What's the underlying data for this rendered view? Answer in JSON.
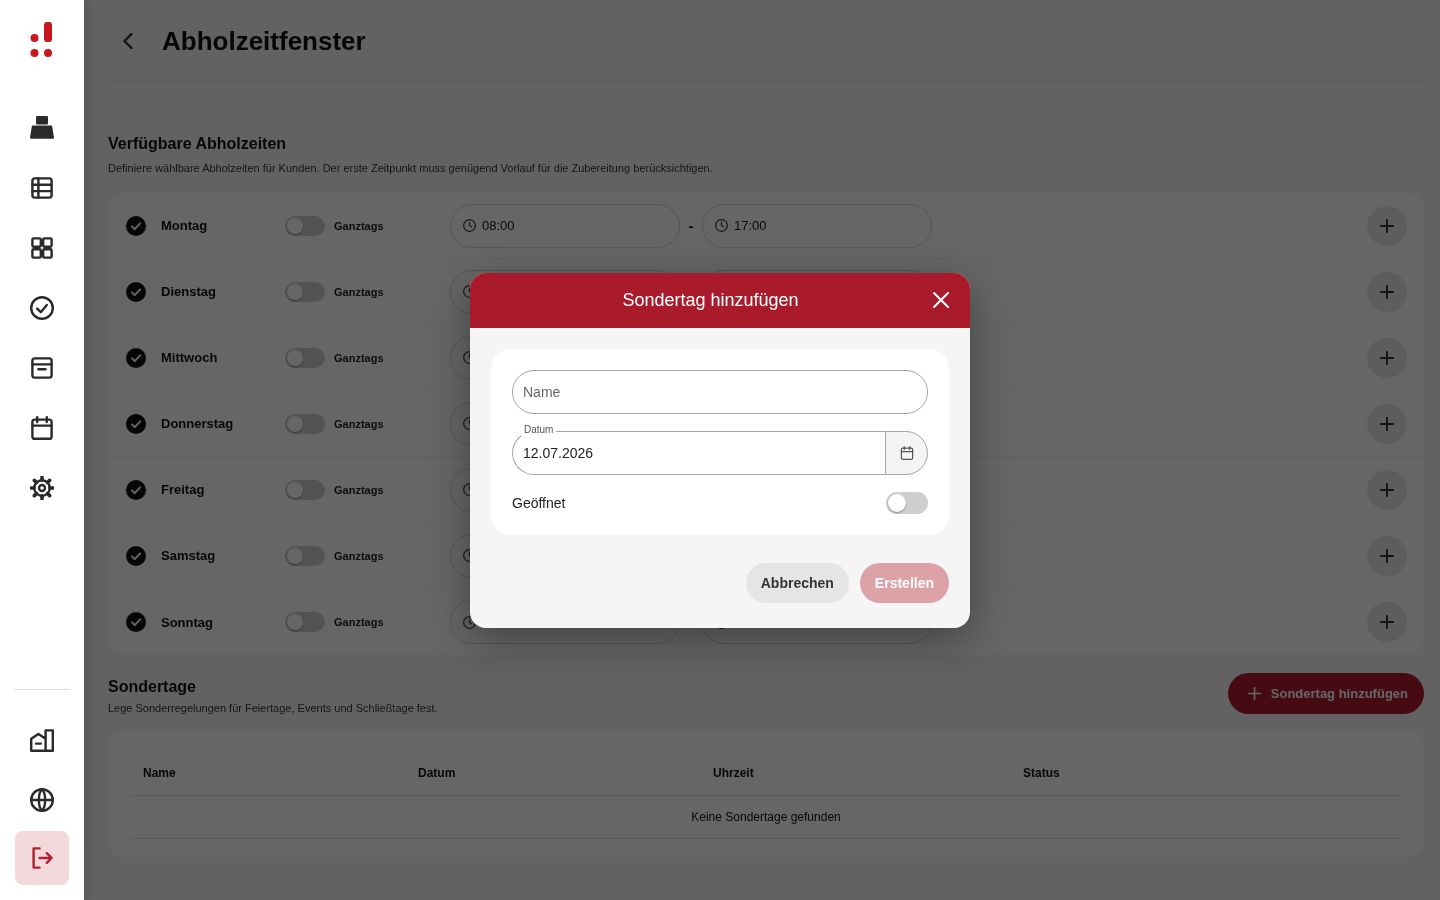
{
  "sidebar": {
    "items": [
      {
        "kind": "nav"
      },
      {
        "kind": "nav"
      },
      {
        "kind": "nav"
      },
      {
        "kind": "nav"
      },
      {
        "kind": "nav"
      },
      {
        "kind": "nav"
      },
      {
        "kind": "nav"
      }
    ],
    "bottom_items": [
      {
        "kind": "nav"
      },
      {
        "kind": "nav"
      },
      {
        "kind": "logout"
      }
    ]
  },
  "header": {
    "title": "Abholzeitfenster"
  },
  "pickup_times": {
    "title": "Verfügbare Abholzeiten",
    "description": "Definiere wählbare Abholzeiten für Kunden. Der erste Zeitpunkt muss genügend Vorlauf für die Zubereitung berücksichtigen.",
    "days": [
      {
        "name": "Montag",
        "enabled": true,
        "all_day": false,
        "all_day_label": "Ganztags",
        "from": "08:00",
        "separator": "-",
        "to": "17:00"
      },
      {
        "name": "Dienstag",
        "enabled": true,
        "all_day": false,
        "all_day_label": "Ganztags"
      },
      {
        "name": "Mittwoch",
        "enabled": true,
        "all_day": false,
        "all_day_label": "Ganztags"
      },
      {
        "name": "Donnerstag",
        "enabled": true,
        "all_day": false,
        "all_day_label": "Ganztags"
      },
      {
        "name": "Freitag",
        "enabled": true,
        "all_day": false,
        "all_day_label": "Ganztags"
      },
      {
        "name": "Samstag",
        "enabled": true,
        "all_day": false,
        "all_day_label": "Ganztags"
      },
      {
        "name": "Sonntag",
        "enabled": true,
        "all_day": false,
        "all_day_label": "Ganztags"
      }
    ]
  },
  "special_days": {
    "title": "Sondertage",
    "description": "Lege Sonderregelungen für Feiertage, Events und Schließtage fest.",
    "add_button": "Sondertag hinzufügen",
    "table": {
      "columns": [
        "Name",
        "Datum",
        "Uhrzeit",
        "Status"
      ],
      "empty_text": "Keine Sondertage gefunden"
    }
  },
  "dialog": {
    "title": "Sondertag hinzufügen",
    "fields": [
      {
        "kind": "text",
        "placeholder": "Name"
      },
      {
        "kind": "date",
        "label": "Datum",
        "value": "12.07.2026"
      }
    ],
    "switch": {
      "label": "Geöffnet",
      "on": false
    },
    "buttons": [
      {
        "label": "Abbrechen",
        "kind": "secondary",
        "disabled": false
      },
      {
        "label": "Erstellen",
        "kind": "primary",
        "disabled": true
      }
    ]
  }
}
